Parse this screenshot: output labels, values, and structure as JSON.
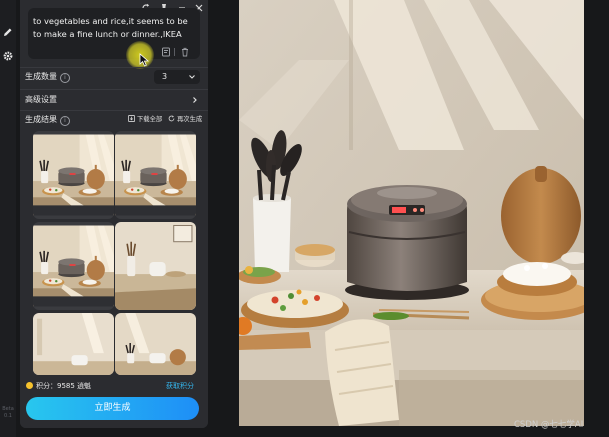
{
  "rail": {
    "icons": [
      "edit-icon",
      "settings-icon"
    ],
    "version": "Beta 0.1"
  },
  "window": {
    "controls": [
      "refresh-icon",
      "pin-icon",
      "minimize-icon",
      "close-icon"
    ]
  },
  "prompt": {
    "text": "to vegetables and rice,it seems to be to make a fine lunch or dinner.,IKEA"
  },
  "quantity": {
    "label": "生成数量",
    "value": "3"
  },
  "advanced": {
    "label": "高级设置"
  },
  "results": {
    "label": "生成结果",
    "download_all": "下载全部",
    "regenerate": "再次生成",
    "thumbnail_count": 6
  },
  "footer": {
    "points_label": "积分：",
    "points_value": "9585",
    "points_suffix": "逍魁",
    "get_points": "获取积分",
    "generate_button": "立即生成"
  },
  "watermark": "CSDN @七七学AI",
  "colors": {
    "accent": "#1e8ef7",
    "accent_start": "#28c7ee",
    "link": "#35b8f0",
    "coin": "#f6c22d",
    "panel_bg": "#2b2c30"
  }
}
